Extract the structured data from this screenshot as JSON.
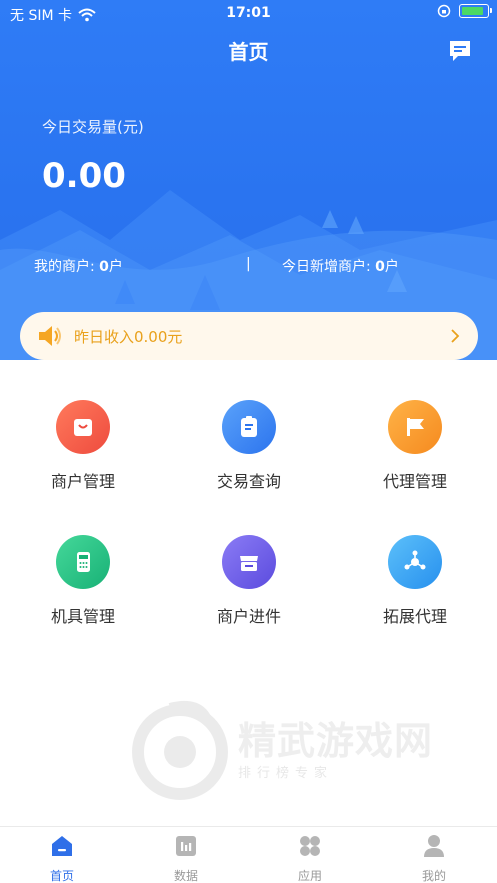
{
  "status_bar": {
    "carrier": "无 SIM 卡",
    "time": "17:01",
    "battery_level": 0.9
  },
  "header": {
    "title": "首页"
  },
  "summary": {
    "trade_label": "今日交易量(元)",
    "trade_value": "0.00",
    "my_merchants_label": "我的商户: ",
    "my_merchants_value": "0",
    "my_merchants_unit": "户",
    "separator": "|",
    "new_merchants_label": "今日新增商户: ",
    "new_merchants_value": "0",
    "new_merchants_unit": "户"
  },
  "notice": {
    "text": "昨日收入0.00元"
  },
  "menu": [
    {
      "label": "商户管理",
      "icon": "shopping-bag-icon",
      "color": "#F25A45"
    },
    {
      "label": "交易查询",
      "icon": "clipboard-icon",
      "color": "#3A86F5"
    },
    {
      "label": "代理管理",
      "icon": "flag-icon",
      "color": "#F79A28"
    },
    {
      "label": "机具管理",
      "icon": "pos-terminal-icon",
      "color": "#27C486"
    },
    {
      "label": "商户进件",
      "icon": "storefront-icon",
      "color": "#7263E8"
    },
    {
      "label": "拓展代理",
      "icon": "network-icon",
      "color": "#35A3F2"
    }
  ],
  "watermark": {
    "title": "精武游戏网",
    "subtitle": "排行榜专家"
  },
  "tabs": [
    {
      "label": "首页",
      "icon": "home-icon",
      "active": true
    },
    {
      "label": "数据",
      "icon": "chart-icon",
      "active": false
    },
    {
      "label": "应用",
      "icon": "apps-icon",
      "active": false
    },
    {
      "label": "我的",
      "icon": "user-icon",
      "active": false
    }
  ],
  "colors": {
    "primary": "#2F7CF6",
    "notice_text": "#E9A11C",
    "tab_active": "#2F6FE8"
  }
}
